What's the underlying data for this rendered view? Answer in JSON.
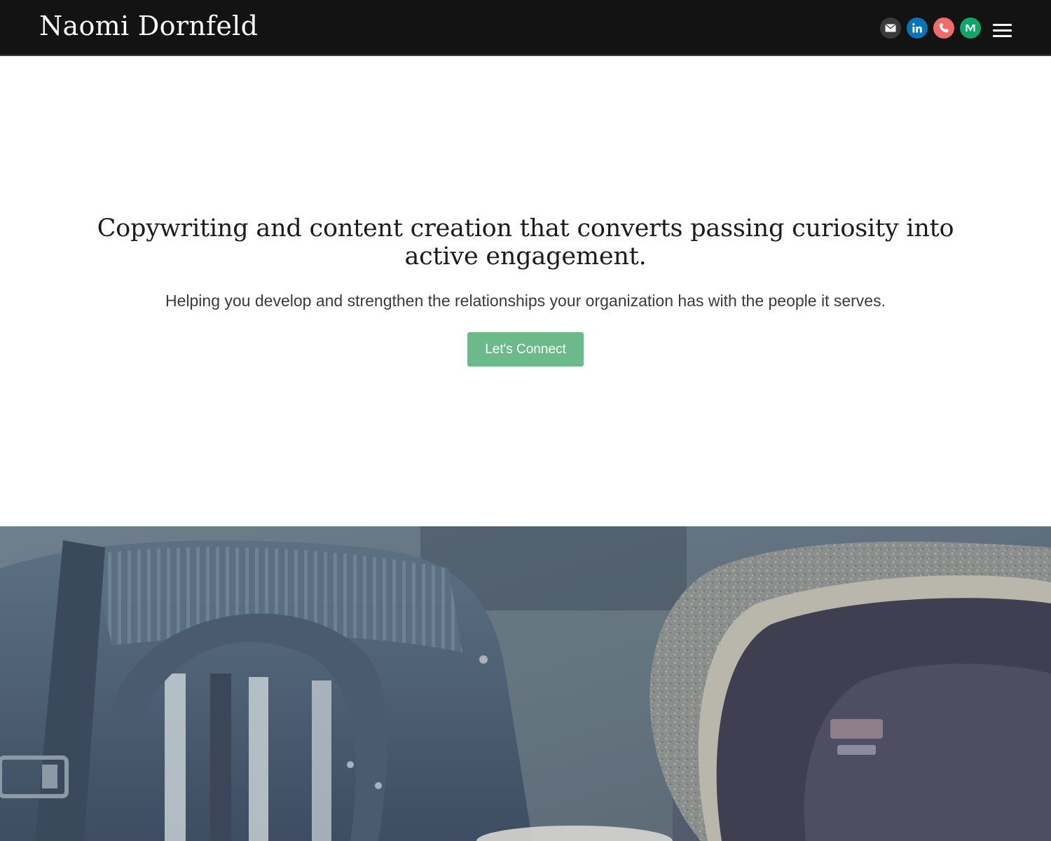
{
  "header": {
    "brand_name": "Naomi Dornfeld",
    "social_links": [
      {
        "icon": "email-icon",
        "color": "#3a3a3a"
      },
      {
        "icon": "linkedin-icon",
        "color": "#0a73b1"
      },
      {
        "icon": "phone-icon",
        "color": "#f26b6b"
      },
      {
        "icon": "medium-icon",
        "color": "#12a56b"
      }
    ],
    "menu_icon": "hamburger-menu-icon"
  },
  "hero": {
    "headline": "Copywriting and content creation that converts passing curiosity into active engagement.",
    "subheadline": "Helping you develop and strengthen the relationships your organization has with the people it serves.",
    "cta_label": "Let's Connect"
  },
  "colors": {
    "header_bg": "#131313",
    "cta_bg": "#6cb98a",
    "photo_tint": "#5a6e80"
  }
}
